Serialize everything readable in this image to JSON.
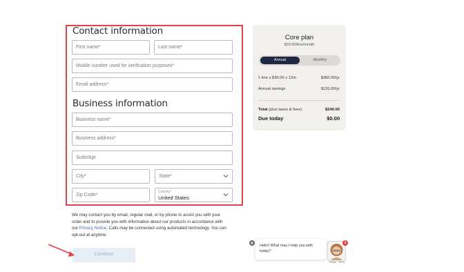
{
  "contact": {
    "heading": "Contact information",
    "first_name_placeholder": "First name*",
    "last_name_placeholder": "Last name*",
    "mobile_placeholder": "Mobile number used for verification purposes*",
    "email_placeholder": "Email address*"
  },
  "business": {
    "heading": "Business information",
    "name_placeholder": "Business name*",
    "address_placeholder": "Business address*",
    "suite_placeholder": "Suite/Apt",
    "city_placeholder": "City*",
    "state_placeholder": "State*",
    "zip_placeholder": "Zip Code*",
    "country_label": "Country*",
    "country_value": "United States"
  },
  "disclaimer": {
    "text_before_link": "We may contact you by email, regular mail, or by phone to assist you with your order and to provide you with information about our products in accordance with our ",
    "link": "Privacy Notice",
    "text_after_link": ". Calls may be connected using automated technology. You can opt-out at anytime."
  },
  "continue_label": "Continue",
  "plan": {
    "title": "Core plan",
    "price": "$20.00/line/month",
    "toggle_annual": "Annual",
    "toggle_monthly": "Monthly",
    "line_label": "1 line x $30.00 x 12m",
    "line_value": "$360.00/yr",
    "savings_label": "Annual savings",
    "savings_value": "$120.00/yr",
    "total_label": "Total",
    "total_suffix": " (plus taxes & fees)",
    "total_value": "$240.00",
    "due_label": "Due today",
    "due_value": "$0.00"
  },
  "chat": {
    "message": "Hello! What may I help you with today?",
    "agent_caption": "Vinay... Terra",
    "badge_count": "1"
  },
  "colors": {
    "highlight_frame": "#e0414a",
    "toggle_active": "#1e2a44",
    "continue_disabled_bg": "#e7eef6",
    "plan_bg": "#f2f0ec"
  }
}
